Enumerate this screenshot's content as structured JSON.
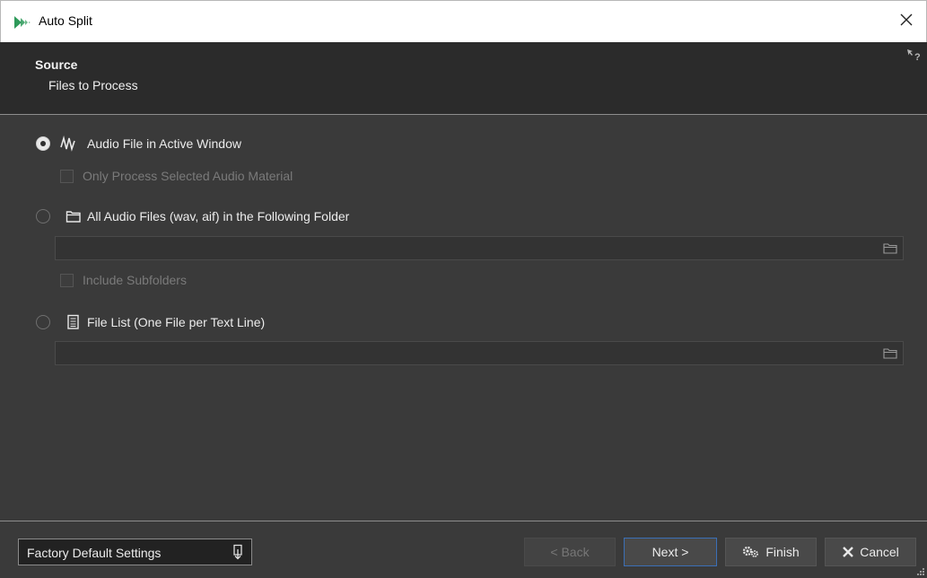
{
  "window": {
    "title": "Auto Split",
    "close_glyph": "✕"
  },
  "header": {
    "title": "Source",
    "subtitle": "Files to Process",
    "help_icon": "context-help-icon"
  },
  "options": {
    "active_window": {
      "label": "Audio File in Active Window",
      "selected": true,
      "icon": "waveform-icon"
    },
    "only_selected": {
      "label": "Only Process Selected Audio Material",
      "checked": false,
      "enabled": false
    },
    "folder": {
      "label": "All Audio Files (wav, aif) in the Following Folder",
      "selected": false,
      "icon": "folder-icon",
      "path_value": ""
    },
    "include_subfolders": {
      "label": "Include Subfolders",
      "checked": false,
      "enabled": false
    },
    "file_list": {
      "label": "File List (One File per Text Line)",
      "selected": false,
      "icon": "text-file-icon",
      "path_value": ""
    }
  },
  "footer": {
    "preset_label": "Factory Default Settings",
    "back_label": "< Back",
    "next_label": "Next >",
    "finish_label": "Finish",
    "cancel_label": "Cancel"
  },
  "colors": {
    "accent": "#3b6fb6",
    "background": "#3a3a3a",
    "header": "#2b2b2b",
    "logo_green": "#2e9a5a"
  }
}
